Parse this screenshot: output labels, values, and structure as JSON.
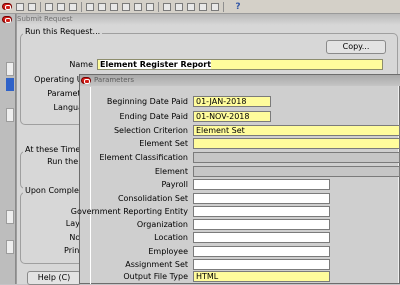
{
  "outer_window": {
    "title": "Submit Request"
  },
  "run_request": {
    "group_title": "Run this Request...",
    "copy_button": "Copy...",
    "name_label": "Name",
    "name_value": "Element Register Report",
    "operating_unit_label": "Operating Unit",
    "parameters_label": "Parameters",
    "language_label": "Language"
  },
  "at_these_times": {
    "group_title": "At these Times...",
    "run_job_label": "Run the Job"
  },
  "upon_completion": {
    "group_title": "Upon Completion...",
    "layout_label": "Layout",
    "notify_label": "Notify",
    "print_to_label": "Print to"
  },
  "help_button": "Help (C)",
  "parameters_dialog": {
    "title": "Parameters",
    "fields": [
      {
        "label": "Beginning Date Paid",
        "value": "01-JAN-2018",
        "style": "yellow"
      },
      {
        "label": "Ending Date Paid",
        "value": "01-NOV-2018",
        "style": "yellow"
      },
      {
        "label": "Selection Criterion",
        "value": "Element Set",
        "style": "yellow"
      },
      {
        "label": "Element Set",
        "value": "",
        "style": "yellow"
      },
      {
        "label": "Element Classification",
        "value": "",
        "style": "grey"
      },
      {
        "label": "Element",
        "value": "",
        "style": "grey"
      },
      {
        "label": "Payroll",
        "value": "",
        "style": "white"
      },
      {
        "label": "Consolidation Set",
        "value": "",
        "style": "white"
      },
      {
        "label": "Government Reporting Entity",
        "value": "",
        "style": "white"
      },
      {
        "label": "Organization",
        "value": "",
        "style": "white"
      },
      {
        "label": "Location",
        "value": "",
        "style": "white"
      },
      {
        "label": "Employee",
        "value": "",
        "style": "white"
      },
      {
        "label": "Assignment Set",
        "value": "",
        "style": "white"
      },
      {
        "label": "Output File Type",
        "value": "HTML",
        "style": "yellow"
      }
    ]
  },
  "toolbar": {
    "help_glyph": "?"
  },
  "colors": {
    "required_field": "#fffc9c",
    "disabled_field": "#c6c6c6",
    "close_button": "#d11d17",
    "selection_blue": "#2f62c8"
  }
}
